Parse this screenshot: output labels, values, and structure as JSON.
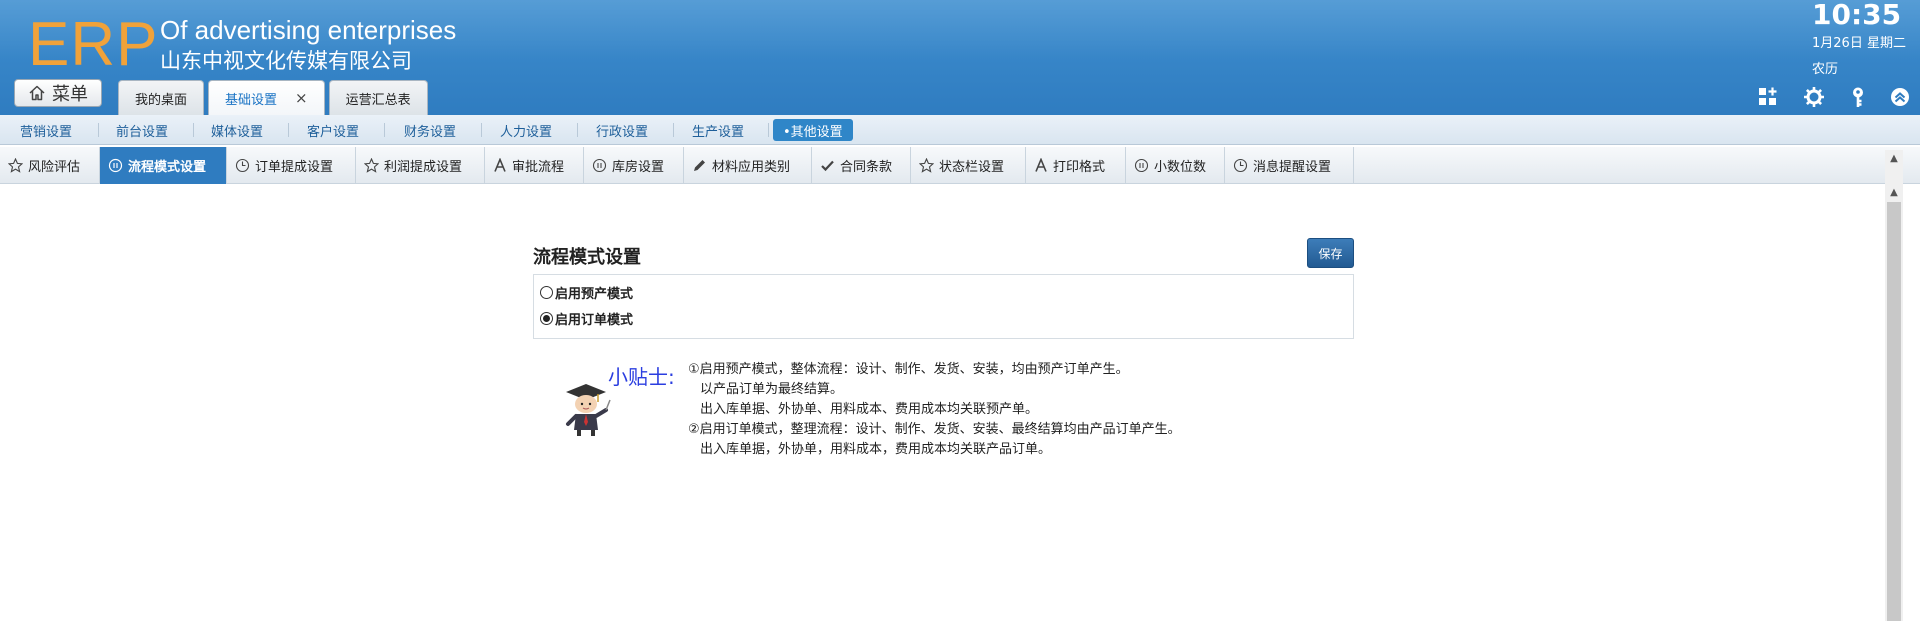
{
  "header": {
    "logo": "ERP",
    "slogan": "Of advertising enterprises",
    "company": "山东中视文化传媒有限公司",
    "menu_label": "菜单",
    "time": "10:35",
    "date": "1月26日 星期二",
    "lunar": "农历",
    "tabs": [
      {
        "label": "我的桌面",
        "active": false,
        "closable": false
      },
      {
        "label": "基础设置",
        "active": true,
        "closable": true
      },
      {
        "label": "运营汇总表",
        "active": false,
        "closable": false
      }
    ],
    "close_glyph": "×",
    "icons": [
      "apps-grid-icon",
      "gear-icon",
      "key-icon",
      "collapse-up-icon"
    ]
  },
  "modules": [
    {
      "label": "营销设置"
    },
    {
      "label": "前台设置"
    },
    {
      "label": "媒体设置"
    },
    {
      "label": "客户设置"
    },
    {
      "label": "财务设置"
    },
    {
      "label": "人力设置"
    },
    {
      "label": "行政设置"
    },
    {
      "label": "生产设置"
    },
    {
      "label": "•其他设置",
      "active": true
    }
  ],
  "subtabs": [
    {
      "label": "风险评估",
      "icon": "star-outline-icon"
    },
    {
      "label": "流程模式设置",
      "icon": "pause-circle-icon",
      "active": true
    },
    {
      "label": "订单提成设置",
      "icon": "clock-icon"
    },
    {
      "label": "利润提成设置",
      "icon": "star-outline-icon"
    },
    {
      "label": "审批流程",
      "icon": "letter-a-icon"
    },
    {
      "label": "库房设置",
      "icon": "pause-circle-icon"
    },
    {
      "label": "材料应用类别",
      "icon": "pencil-icon"
    },
    {
      "label": "合同条款",
      "icon": "check-icon"
    },
    {
      "label": "状态栏设置",
      "icon": "star-outline-icon"
    },
    {
      "label": "打印格式",
      "icon": "letter-a-icon"
    },
    {
      "label": "小数位数",
      "icon": "pause-circle-icon"
    },
    {
      "label": "消息提醒设置",
      "icon": "clock-icon"
    }
  ],
  "content": {
    "title": "流程模式设置",
    "save_label": "保存",
    "options": [
      {
        "label": "启用预产模式",
        "selected": false
      },
      {
        "label": "启用订单模式",
        "selected": true
      }
    ],
    "tips_label": "小贴士:",
    "tips": [
      "①启用预产模式，整体流程：设计、制作、发货、安装，均由预产订单产生。",
      "以产品订单为最终结算。",
      "出入库单据、外协单、用料成本、费用成本均关联预产单。",
      "②启用订单模式，整理流程：设计、制作、发货、安装、最终结算均由产品订单产生。",
      "出入库单据，外协单，用料成本，费用成本均关联产品订单。"
    ]
  },
  "colors": {
    "header_blue": "#2f7cc0",
    "logo_orange": "#f0a23a",
    "active_tab_blue": "#2f7cc0",
    "tip_blue": "#2b3ee0",
    "save_button": "#2c6aa5"
  }
}
